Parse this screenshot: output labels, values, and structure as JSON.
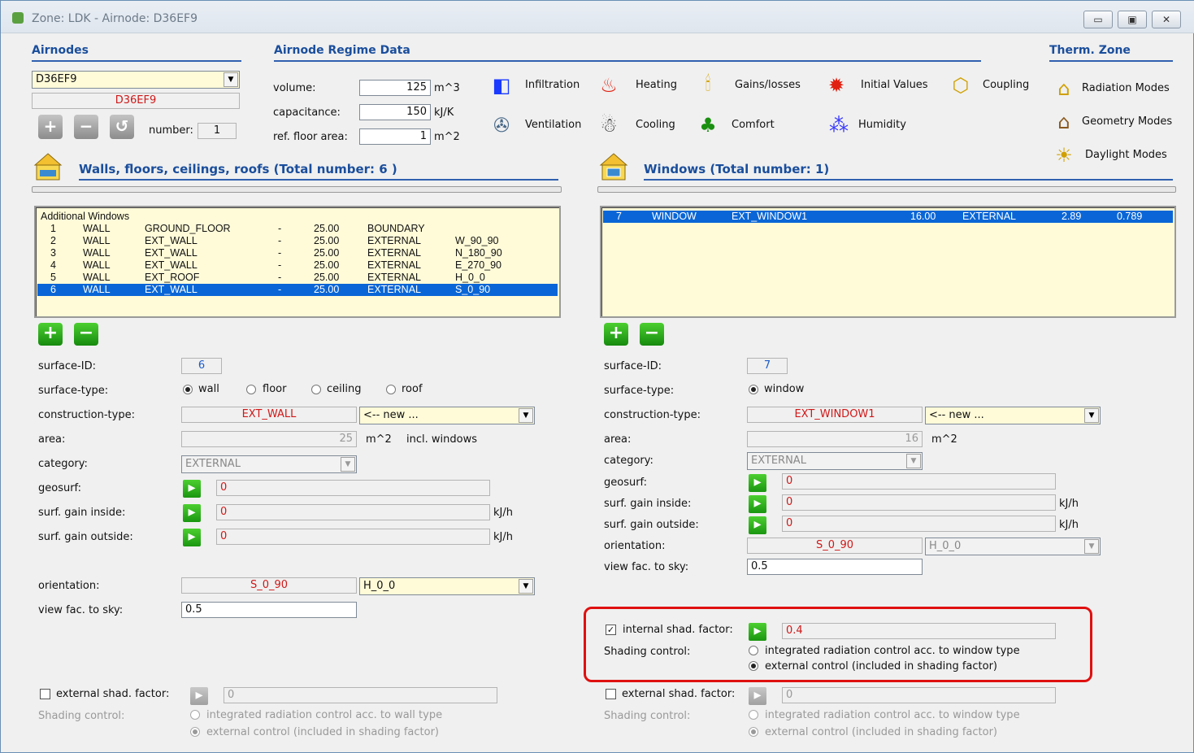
{
  "window": {
    "title": "Zone: LDK  -  Airnode: D36EF9",
    "min": "▭",
    "max": "▣",
    "close": "✕"
  },
  "airnodes": {
    "header": "Airnodes",
    "selected": "D36EF9",
    "name": "D36EF9",
    "number_label": "number:",
    "number": "1"
  },
  "regime": {
    "header": "Airnode Regime Data",
    "volume_label": "volume:",
    "volume": "125",
    "volume_unit": "m^3",
    "cap_label": "capacitance:",
    "cap": "150",
    "cap_unit": "kJ/K",
    "floor_label": "ref. floor area:",
    "floor": "1",
    "floor_unit": "m^2"
  },
  "buttons": {
    "infiltration": "Infiltration",
    "heating": "Heating",
    "gains": "Gains/losses",
    "initial": "Initial Values",
    "coupling": "Coupling",
    "ventilation": "Ventilation",
    "cooling": "Cooling",
    "comfort": "Comfort",
    "humidity": "Humidity"
  },
  "therm": {
    "header": "Therm. Zone",
    "radiation": "Radiation Modes",
    "geometry": "Geometry Modes",
    "daylight": "Daylight Modes"
  },
  "walls": {
    "header": "Walls, floors, ceilings, roofs (Total number: 6 )",
    "list_title": "Additional Windows",
    "rows": [
      {
        "id": "1",
        "type": "WALL",
        "cons": "GROUND_FLOOR",
        "dash": "-",
        "area": "25.00",
        "cat": "BOUNDARY",
        "orient": ""
      },
      {
        "id": "2",
        "type": "WALL",
        "cons": "EXT_WALL",
        "dash": "-",
        "area": "25.00",
        "cat": "EXTERNAL",
        "orient": "W_90_90"
      },
      {
        "id": "3",
        "type": "WALL",
        "cons": "EXT_WALL",
        "dash": "-",
        "area": "25.00",
        "cat": "EXTERNAL",
        "orient": "N_180_90"
      },
      {
        "id": "4",
        "type": "WALL",
        "cons": "EXT_WALL",
        "dash": "-",
        "area": "25.00",
        "cat": "EXTERNAL",
        "orient": "E_270_90"
      },
      {
        "id": "5",
        "type": "WALL",
        "cons": "EXT_ROOF",
        "dash": "-",
        "area": "25.00",
        "cat": "EXTERNAL",
        "orient": "H_0_0"
      },
      {
        "id": "6",
        "type": "WALL",
        "cons": "EXT_WALL",
        "dash": "-",
        "area": "25.00",
        "cat": "EXTERNAL",
        "orient": "S_0_90"
      }
    ],
    "surface_id_label": "surface-ID:",
    "surface_id": "6",
    "surface_type_label": "surface-type:",
    "wall": "wall",
    "floor": "floor",
    "ceiling": "ceiling",
    "roof": "roof",
    "cons_label": "construction-type:",
    "cons": "EXT_WALL",
    "new": "<-- new ...",
    "area_label": "area:",
    "area": "25",
    "area_unit": "m^2",
    "incl": "incl. windows",
    "cat_label": "category:",
    "cat": "EXTERNAL",
    "geosurf_label": "geosurf:",
    "geosurf": "0",
    "gain_in_label": "surf. gain inside:",
    "gain_in": "0",
    "gain_in_unit": "kJ/h",
    "gain_out_label": "surf. gain outside:",
    "gain_out": "0",
    "gain_out_unit": "kJ/h",
    "orient_label": "orientation:",
    "orient": "S_0_90",
    "orient2": "H_0_0",
    "vfs_label": "view fac. to sky:",
    "vfs": "0.5",
    "ext_shad_label": "external shad. factor:",
    "ext_shad": "0",
    "shad_ctrl_label": "Shading control:",
    "opt1": "integrated radiation control acc. to wall type",
    "opt2": "external control (included in shading factor)"
  },
  "windows": {
    "header": "Windows (Total number: 1)",
    "row": {
      "id": "7",
      "type": "WINDOW",
      "cons": "EXT_WINDOW1",
      "area": "16.00",
      "cat": "EXTERNAL",
      "u": "2.89",
      "g": "0.789"
    },
    "surface_id_label": "surface-ID:",
    "surface_id": "7",
    "surface_type_label": "surface-type:",
    "window": "window",
    "cons_label": "construction-type:",
    "cons": "EXT_WINDOW1",
    "new": "<-- new ...",
    "area_label": "area:",
    "area": "16",
    "area_unit": "m^2",
    "cat_label": "category:",
    "cat": "EXTERNAL",
    "geosurf_label": "geosurf:",
    "geosurf": "0",
    "gain_in_label": "surf. gain inside:",
    "gain_in": "0",
    "gain_in_unit": "kJ/h",
    "gain_out_label": "surf. gain outside:",
    "gain_out": "0",
    "gain_out_unit": "kJ/h",
    "orient_label": "orientation:",
    "orient": "S_0_90",
    "orient2": "H_0_0",
    "vfs_label": "view fac. to sky:",
    "vfs": "0.5",
    "int_shad_label": "internal shad. factor:",
    "int_shad": "0.4",
    "shad_ctrl_label": "Shading control:",
    "int_opt1": "integrated radiation control acc. to window type",
    "int_opt2": "external control (included in shading factor)",
    "ext_shad_label": "external shad. factor:",
    "ext_shad": "0",
    "ext_shad_ctrl_label": "Shading control:",
    "ext_opt1": "integrated radiation control acc. to window type",
    "ext_opt2": "external control (included in shading factor)"
  }
}
